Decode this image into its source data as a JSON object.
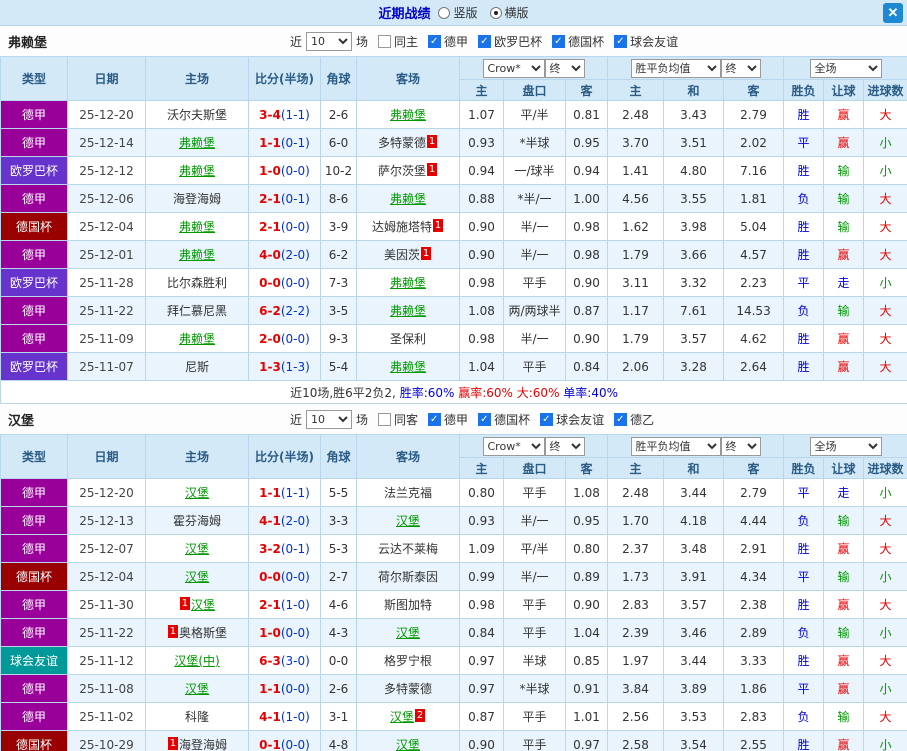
{
  "titlebar": {
    "title": "近期战绩",
    "radios": [
      {
        "label": "竖版",
        "selected": false
      },
      {
        "label": "横版",
        "selected": true
      }
    ],
    "close": "✕"
  },
  "colors": {
    "header_bg": "#d3e9f8",
    "title_text": "#0000cc",
    "close_btn": "#1e88d2",
    "self_team": "#009900",
    "score_main": "#e60000",
    "score_half": "#0033cc",
    "type": {
      "德甲": "#990099",
      "欧罗巴杯": "#6633cc",
      "德国杯": "#990000",
      "球会友谊": "#009999"
    },
    "result": {
      "b": "#0000dd",
      "r": "#e60000",
      "g": "#009900"
    }
  },
  "sections": [
    {
      "team": "弗赖堡",
      "filter": {
        "prefix": "近",
        "count": "10",
        "suffix": "场",
        "checks": [
          {
            "label": "同主",
            "checked": false
          },
          {
            "label": "德甲",
            "checked": true
          },
          {
            "label": "欧罗巴杯",
            "checked": true
          },
          {
            "label": "德国杯",
            "checked": true
          },
          {
            "label": "球会友谊",
            "checked": true
          }
        ]
      },
      "selects": {
        "odds": "Crow*",
        "odds_final": "终",
        "avg": "胜平负均值",
        "avg_final": "终",
        "scope": "全场"
      },
      "headers": {
        "type": "类型",
        "date": "日期",
        "home": "主场",
        "score": "比分(半场)",
        "corner": "角球",
        "away": "客场",
        "sub": [
          "主",
          "盘口",
          "客",
          "主",
          "和",
          "客",
          "胜负",
          "让球",
          "进球数"
        ]
      },
      "rows": [
        {
          "type": "德甲",
          "date": "25-12-20",
          "home": {
            "name": "沃尔夫斯堡"
          },
          "score": "3-4",
          "half": "(1-1)",
          "corner": "2-6",
          "away": {
            "name": "弗赖堡",
            "self": true
          },
          "odds": [
            "1.07",
            "平/半",
            "0.81"
          ],
          "avg": [
            "2.48",
            "3.43",
            "2.79"
          ],
          "results": [
            [
              "胜",
              "b"
            ],
            [
              "赢",
              "r"
            ],
            [
              "大",
              "r"
            ]
          ]
        },
        {
          "type": "德甲",
          "date": "25-12-14",
          "home": {
            "name": "弗赖堡",
            "self": true
          },
          "score": "1-1",
          "half": "(0-1)",
          "corner": "6-0",
          "away": {
            "name": "多特蒙德",
            "card_post": "1"
          },
          "odds": [
            "0.93",
            "*半球",
            "0.95"
          ],
          "avg": [
            "3.70",
            "3.51",
            "2.02"
          ],
          "results": [
            [
              "平",
              "b"
            ],
            [
              "赢",
              "r"
            ],
            [
              "小",
              "g"
            ]
          ]
        },
        {
          "type": "欧罗巴杯",
          "date": "25-12-12",
          "home": {
            "name": "弗赖堡",
            "self": true
          },
          "score": "1-0",
          "half": "(0-0)",
          "corner": "10-2",
          "away": {
            "name": "萨尔茨堡",
            "card_post": "1"
          },
          "odds": [
            "0.94",
            "一/球半",
            "0.94"
          ],
          "avg": [
            "1.41",
            "4.80",
            "7.16"
          ],
          "results": [
            [
              "胜",
              "b"
            ],
            [
              "输",
              "g"
            ],
            [
              "小",
              "g"
            ]
          ]
        },
        {
          "type": "德甲",
          "date": "25-12-06",
          "home": {
            "name": "海登海姆"
          },
          "score": "2-1",
          "half": "(0-1)",
          "corner": "8-6",
          "away": {
            "name": "弗赖堡",
            "self": true
          },
          "odds": [
            "0.88",
            "*半/一",
            "1.00"
          ],
          "avg": [
            "4.56",
            "3.55",
            "1.81"
          ],
          "results": [
            [
              "负",
              "b"
            ],
            [
              "输",
              "g"
            ],
            [
              "大",
              "r"
            ]
          ]
        },
        {
          "type": "德国杯",
          "date": "25-12-04",
          "home": {
            "name": "弗赖堡",
            "self": true
          },
          "score": "2-1",
          "half": "(0-0)",
          "corner": "3-9",
          "away": {
            "name": "达姆施塔特",
            "card_post": "1"
          },
          "odds": [
            "0.90",
            "半/一",
            "0.98"
          ],
          "avg": [
            "1.62",
            "3.98",
            "5.04"
          ],
          "results": [
            [
              "胜",
              "b"
            ],
            [
              "输",
              "g"
            ],
            [
              "大",
              "r"
            ]
          ]
        },
        {
          "type": "德甲",
          "date": "25-12-01",
          "home": {
            "name": "弗赖堡",
            "self": true
          },
          "score": "4-0",
          "half": "(2-0)",
          "corner": "6-2",
          "away": {
            "name": "美因茨",
            "card_post": "1"
          },
          "odds": [
            "0.90",
            "半/一",
            "0.98"
          ],
          "avg": [
            "1.79",
            "3.66",
            "4.57"
          ],
          "results": [
            [
              "胜",
              "b"
            ],
            [
              "赢",
              "r"
            ],
            [
              "大",
              "r"
            ]
          ]
        },
        {
          "type": "欧罗巴杯",
          "date": "25-11-28",
          "home": {
            "name": "比尔森胜利"
          },
          "score": "0-0",
          "half": "(0-0)",
          "corner": "7-3",
          "away": {
            "name": "弗赖堡",
            "self": true
          },
          "odds": [
            "0.98",
            "平手",
            "0.90"
          ],
          "avg": [
            "3.11",
            "3.32",
            "2.23"
          ],
          "results": [
            [
              "平",
              "b"
            ],
            [
              "走",
              "b"
            ],
            [
              "小",
              "g"
            ]
          ]
        },
        {
          "type": "德甲",
          "date": "25-11-22",
          "home": {
            "name": "拜仁慕尼黑"
          },
          "score": "6-2",
          "half": "(2-2)",
          "corner": "3-5",
          "away": {
            "name": "弗赖堡",
            "self": true
          },
          "odds": [
            "1.08",
            "两/两球半",
            "0.87"
          ],
          "avg": [
            "1.17",
            "7.61",
            "14.53"
          ],
          "results": [
            [
              "负",
              "b"
            ],
            [
              "输",
              "g"
            ],
            [
              "大",
              "r"
            ]
          ]
        },
        {
          "type": "德甲",
          "date": "25-11-09",
          "home": {
            "name": "弗赖堡",
            "self": true
          },
          "score": "2-0",
          "half": "(0-0)",
          "corner": "9-3",
          "away": {
            "name": "圣保利"
          },
          "odds": [
            "0.98",
            "半/一",
            "0.90"
          ],
          "avg": [
            "1.79",
            "3.57",
            "4.62"
          ],
          "results": [
            [
              "胜",
              "b"
            ],
            [
              "赢",
              "r"
            ],
            [
              "大",
              "r"
            ]
          ]
        },
        {
          "type": "欧罗巴杯",
          "date": "25-11-07",
          "home": {
            "name": "尼斯"
          },
          "score": "1-3",
          "half": "(1-3)",
          "corner": "5-4",
          "away": {
            "name": "弗赖堡",
            "self": true
          },
          "odds": [
            "1.04",
            "平手",
            "0.84"
          ],
          "avg": [
            "2.06",
            "3.28",
            "2.64"
          ],
          "results": [
            [
              "胜",
              "b"
            ],
            [
              "赢",
              "r"
            ],
            [
              "大",
              "r"
            ]
          ]
        }
      ],
      "summary": [
        {
          "text": "近10场,胜6平2负2, ",
          "color": "#333333"
        },
        {
          "text": "胜率:60% ",
          "color": "#0000dd"
        },
        {
          "text": "赢率:60% ",
          "color": "#e60000"
        },
        {
          "text": "大:60% ",
          "color": "#e60000"
        },
        {
          "text": "单率:40%",
          "color": "#0000dd"
        }
      ]
    },
    {
      "team": "汉堡",
      "filter": {
        "prefix": "近",
        "count": "10",
        "suffix": "场",
        "checks": [
          {
            "label": "同客",
            "checked": false
          },
          {
            "label": "德甲",
            "checked": true
          },
          {
            "label": "德国杯",
            "checked": true
          },
          {
            "label": "球会友谊",
            "checked": true
          },
          {
            "label": "德乙",
            "checked": true
          }
        ]
      },
      "selects": {
        "odds": "Crow*",
        "odds_final": "终",
        "avg": "胜平负均值",
        "avg_final": "终",
        "scope": "全场"
      },
      "headers": {
        "type": "类型",
        "date": "日期",
        "home": "主场",
        "score": "比分(半场)",
        "corner": "角球",
        "away": "客场",
        "sub": [
          "主",
          "盘口",
          "客",
          "主",
          "和",
          "客",
          "胜负",
          "让球",
          "进球数"
        ]
      },
      "rows": [
        {
          "type": "德甲",
          "date": "25-12-20",
          "home": {
            "name": "汉堡",
            "self": true
          },
          "score": "1-1",
          "half": "(1-1)",
          "corner": "5-5",
          "away": {
            "name": "法兰克福"
          },
          "odds": [
            "0.80",
            "平手",
            "1.08"
          ],
          "avg": [
            "2.48",
            "3.44",
            "2.79"
          ],
          "results": [
            [
              "平",
              "b"
            ],
            [
              "走",
              "b"
            ],
            [
              "小",
              "g"
            ]
          ]
        },
        {
          "type": "德甲",
          "date": "25-12-13",
          "home": {
            "name": "霍芬海姆"
          },
          "score": "4-1",
          "half": "(2-0)",
          "corner": "3-3",
          "away": {
            "name": "汉堡",
            "self": true
          },
          "odds": [
            "0.93",
            "半/一",
            "0.95"
          ],
          "avg": [
            "1.70",
            "4.18",
            "4.44"
          ],
          "results": [
            [
              "负",
              "b"
            ],
            [
              "输",
              "g"
            ],
            [
              "大",
              "r"
            ]
          ]
        },
        {
          "type": "德甲",
          "date": "25-12-07",
          "home": {
            "name": "汉堡",
            "self": true
          },
          "score": "3-2",
          "half": "(0-1)",
          "corner": "5-3",
          "away": {
            "name": "云达不莱梅"
          },
          "odds": [
            "1.09",
            "平/半",
            "0.80"
          ],
          "avg": [
            "2.37",
            "3.48",
            "2.91"
          ],
          "results": [
            [
              "胜",
              "b"
            ],
            [
              "赢",
              "r"
            ],
            [
              "大",
              "r"
            ]
          ]
        },
        {
          "type": "德国杯",
          "date": "25-12-04",
          "home": {
            "name": "汉堡",
            "self": true
          },
          "score": "0-0",
          "half": "(0-0)",
          "corner": "2-7",
          "away": {
            "name": "荷尔斯泰因"
          },
          "odds": [
            "0.99",
            "半/一",
            "0.89"
          ],
          "avg": [
            "1.73",
            "3.91",
            "4.34"
          ],
          "results": [
            [
              "平",
              "b"
            ],
            [
              "输",
              "g"
            ],
            [
              "小",
              "g"
            ]
          ]
        },
        {
          "type": "德甲",
          "date": "25-11-30",
          "home": {
            "name": "汉堡",
            "self": true,
            "card_pre": "1"
          },
          "score": "2-1",
          "half": "(1-0)",
          "corner": "4-6",
          "away": {
            "name": "斯图加特"
          },
          "odds": [
            "0.98",
            "平手",
            "0.90"
          ],
          "avg": [
            "2.83",
            "3.57",
            "2.38"
          ],
          "results": [
            [
              "胜",
              "b"
            ],
            [
              "赢",
              "r"
            ],
            [
              "大",
              "r"
            ]
          ]
        },
        {
          "type": "德甲",
          "date": "25-11-22",
          "home": {
            "name": "奥格斯堡",
            "card_pre": "1"
          },
          "score": "1-0",
          "half": "(0-0)",
          "corner": "4-3",
          "away": {
            "name": "汉堡",
            "self": true
          },
          "odds": [
            "0.84",
            "平手",
            "1.04"
          ],
          "avg": [
            "2.39",
            "3.46",
            "2.89"
          ],
          "results": [
            [
              "负",
              "b"
            ],
            [
              "输",
              "g"
            ],
            [
              "小",
              "g"
            ]
          ]
        },
        {
          "type": "球会友谊",
          "date": "25-11-12",
          "home": {
            "name": "汉堡(中)",
            "self": true
          },
          "score": "6-3",
          "half": "(3-0)",
          "corner": "0-0",
          "away": {
            "name": "格罗宁根"
          },
          "odds": [
            "0.97",
            "半球",
            "0.85"
          ],
          "avg": [
            "1.97",
            "3.44",
            "3.33"
          ],
          "results": [
            [
              "胜",
              "b"
            ],
            [
              "赢",
              "r"
            ],
            [
              "大",
              "r"
            ]
          ]
        },
        {
          "type": "德甲",
          "date": "25-11-08",
          "home": {
            "name": "汉堡",
            "self": true
          },
          "score": "1-1",
          "half": "(0-0)",
          "corner": "2-6",
          "away": {
            "name": "多特蒙德"
          },
          "odds": [
            "0.97",
            "*半球",
            "0.91"
          ],
          "avg": [
            "3.84",
            "3.89",
            "1.86"
          ],
          "results": [
            [
              "平",
              "b"
            ],
            [
              "赢",
              "r"
            ],
            [
              "小",
              "g"
            ]
          ]
        },
        {
          "type": "德甲",
          "date": "25-11-02",
          "home": {
            "name": "科隆"
          },
          "score": "4-1",
          "half": "(1-0)",
          "corner": "3-1",
          "away": {
            "name": "汉堡",
            "self": true,
            "card_post": "2"
          },
          "odds": [
            "0.87",
            "平手",
            "1.01"
          ],
          "avg": [
            "2.56",
            "3.53",
            "2.83"
          ],
          "results": [
            [
              "负",
              "b"
            ],
            [
              "输",
              "g"
            ],
            [
              "大",
              "r"
            ]
          ]
        },
        {
          "type": "德国杯",
          "date": "25-10-29",
          "home": {
            "name": "海登海姆",
            "card_pre": "1"
          },
          "score": "0-1",
          "half": "(0-0)",
          "corner": "4-8",
          "away": {
            "name": "汉堡",
            "self": true
          },
          "odds": [
            "0.90",
            "平手",
            "0.97"
          ],
          "avg": [
            "2.58",
            "3.54",
            "2.55"
          ],
          "results": [
            [
              "胜",
              "b"
            ],
            [
              "赢",
              "r"
            ],
            [
              "小",
              "g"
            ]
          ]
        }
      ],
      "summary": null
    }
  ]
}
